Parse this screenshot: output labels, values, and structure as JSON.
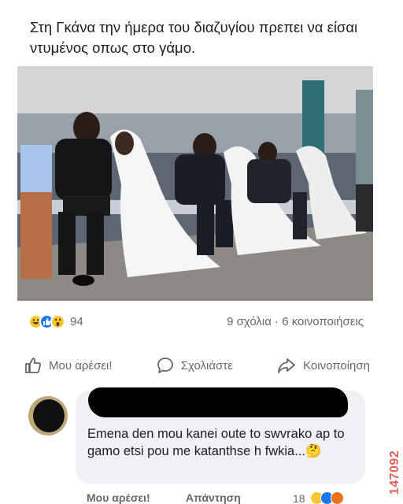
{
  "post": {
    "text": "Στη Γκάνα την ήμερα του διαζυγίου πρεπει να είσαι ντυμένος οπως στο γάμο."
  },
  "reactions": {
    "icons": [
      "haha-icon",
      "like-icon",
      "wow-icon"
    ],
    "count": "94",
    "stats": "9 σχόλια · 6 κοινοποιήσεις"
  },
  "actions": {
    "like": "Μου αρέσει!",
    "comment": "Σχολιάστε",
    "share": "Κοινοποίηση"
  },
  "comment": {
    "text": "Emena den mou kanei oute to swvrako ap to gamo etsi pou me katanthse h fwkia...🤔",
    "like": "Μου αρέσει!",
    "reply": "Απάντηση",
    "reaction_count": "18",
    "reaction_icons": [
      "haha-icon",
      "like-icon",
      "angry-icon"
    ]
  },
  "watermark": "147092",
  "colors": {
    "like_blue": "#1877f2",
    "haha_yellow": "#f7c531",
    "angry_orange": "#e9711c",
    "watermark_red": "#e0615c"
  }
}
